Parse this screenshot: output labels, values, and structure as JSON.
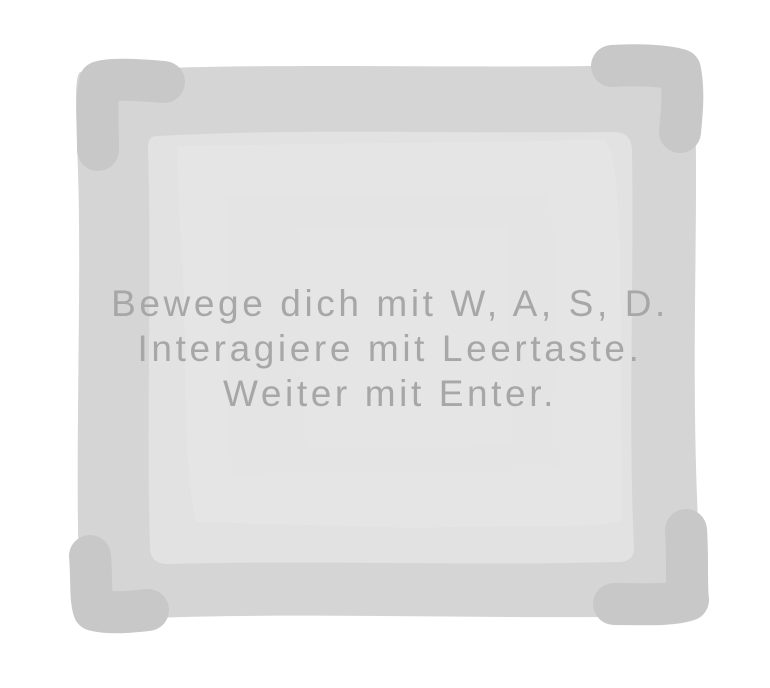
{
  "dialog": {
    "lines": [
      "Bewege dich mit W, A, S, D.",
      "Interagiere mit Leertaste.",
      "Weiter mit Enter."
    ]
  },
  "colors": {
    "background": "#ffffff",
    "panel": "#e3e3e3",
    "border": "#d4d4d4",
    "corner": "#c8c8c8",
    "text": "#a7a7a7"
  }
}
